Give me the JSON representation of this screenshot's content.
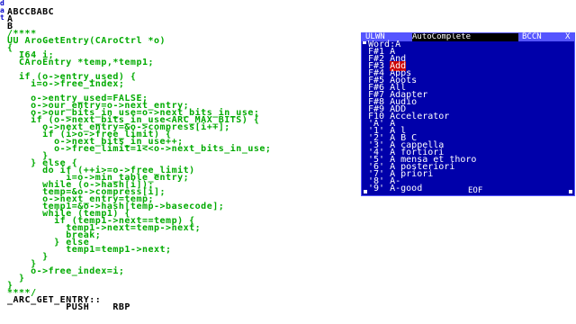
{
  "gutter": [
    "d",
    "a",
    "t"
  ],
  "editor": {
    "lines": [
      {
        "text": "ABCCBABC",
        "cls": "hdr"
      },
      {
        "text": "A",
        "cls": "hdr"
      },
      {
        "text": "B",
        "cls": "hdr"
      },
      {
        "text": "/****",
        "cls": "code"
      },
      {
        "text": "UU AroGetEntry(CAroCtrl *o)",
        "cls": "code"
      },
      {
        "text": "{",
        "cls": "code"
      },
      {
        "text": "  I64 i;",
        "cls": "code"
      },
      {
        "text": "  CAroEntry *temp,*temp1;",
        "cls": "code"
      },
      {
        "text": "",
        "cls": "code"
      },
      {
        "text": "  if (o->entry_used) {",
        "cls": "code"
      },
      {
        "text": "    i=o->free_index;",
        "cls": "code"
      },
      {
        "text": "",
        "cls": "code"
      },
      {
        "text": "    o->entry_used=FALSE;",
        "cls": "code"
      },
      {
        "text": "    o->our_entry=o->next_entry;",
        "cls": "code"
      },
      {
        "text": "    o->our_bits_in_use=o->next_bits_in_use;",
        "cls": "code"
      },
      {
        "text": "    if (o->next_bits_in_use<ARC_MAX_BITS) {",
        "cls": "code"
      },
      {
        "text": "      o->next_entry=&o->compress[i++];",
        "cls": "code"
      },
      {
        "text": "      if (i>o->free_limit) {",
        "cls": "code"
      },
      {
        "text": "        o->next_bits_in_use++;",
        "cls": "code"
      },
      {
        "text": "        o->free_limit=1<<o->next_bits_in_use;",
        "cls": "code"
      },
      {
        "text": "      }",
        "cls": "code"
      },
      {
        "text": "    } else {",
        "cls": "code"
      },
      {
        "text": "      do if (++i>=o->free_limit)",
        "cls": "code"
      },
      {
        "text": "          i=o->min_table_entry;",
        "cls": "code"
      },
      {
        "text": "      while (o->hash[i]);",
        "cls": "code"
      },
      {
        "text": "      temp=&o->compress[i];",
        "cls": "code"
      },
      {
        "text": "      o->next_entry=temp;",
        "cls": "code"
      },
      {
        "text": "      temp1=&o->hash[temp->basecode];",
        "cls": "code"
      },
      {
        "text": "      while (temp1) {",
        "cls": "code"
      },
      {
        "text": "        if (temp1->next==temp) {",
        "cls": "code"
      },
      {
        "text": "          temp1->next=temp->next;",
        "cls": "code"
      },
      {
        "text": "          break;",
        "cls": "code"
      },
      {
        "text": "        } else",
        "cls": "code"
      },
      {
        "text": "          temp1=temp1->next;",
        "cls": "code"
      },
      {
        "text": "      }",
        "cls": "code"
      },
      {
        "text": "    }",
        "cls": "code"
      },
      {
        "text": "    o->free_index=i;",
        "cls": "code"
      },
      {
        "text": "  }",
        "cls": "code"
      },
      {
        "text": "}",
        "cls": "code"
      },
      {
        "text": "****/",
        "cls": "code"
      },
      {
        "text": "_ARC_GET_ENTRY::",
        "cls": "hdr"
      },
      {
        "text": "          PUSH    RBP",
        "cls": "hdr"
      }
    ]
  },
  "popup": {
    "title_left": "ULWN",
    "title_mid": "AutoComplete",
    "title_right": "BCCN",
    "close_label": "X",
    "selected_index": 3,
    "items": [
      {
        "key": "Word:",
        "val": "A"
      },
      {
        "key": "F#1 ",
        "val": "A"
      },
      {
        "key": "F#2 ",
        "val": "And"
      },
      {
        "key": "F#3 ",
        "val": "Add"
      },
      {
        "key": "F#4 ",
        "val": "Apps"
      },
      {
        "key": "F#5 ",
        "val": "Aoots"
      },
      {
        "key": "F#6 ",
        "val": "All"
      },
      {
        "key": "F#7 ",
        "val": "Adapter"
      },
      {
        "key": "F#8 ",
        "val": "Audio"
      },
      {
        "key": "F#9 ",
        "val": "ADD"
      },
      {
        "key": "F10 ",
        "val": "Accelerator"
      },
      {
        "key": "'A' ",
        "val": "A"
      },
      {
        "key": "'1' ",
        "val": "A l"
      },
      {
        "key": "'2' ",
        "val": "A B C"
      },
      {
        "key": "'3' ",
        "val": "A cappella"
      },
      {
        "key": "'4' ",
        "val": "A fortiori"
      },
      {
        "key": "'5' ",
        "val": "A mensa et thoro"
      },
      {
        "key": "'6' ",
        "val": "A posteriori"
      },
      {
        "key": "'7' ",
        "val": "A priori"
      },
      {
        "key": "'8' ",
        "val": "A-"
      },
      {
        "key": "'9' ",
        "val": "A-good"
      }
    ],
    "status": "EOF"
  }
}
